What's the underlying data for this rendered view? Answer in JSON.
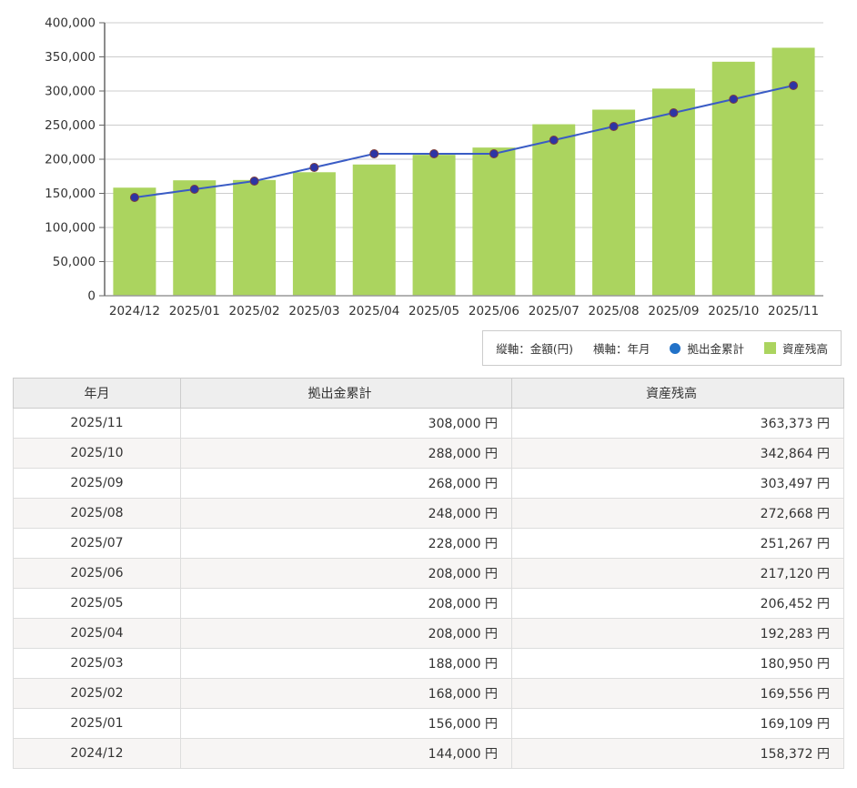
{
  "chart": {
    "legend": {
      "y_axis_label": "縦軸：金額(円)",
      "x_axis_label": "横軸：年月",
      "line_series_label": "拠出金累計",
      "bar_series_label": "資産残高"
    },
    "colors": {
      "bar": "#abd45f",
      "line": "#3a5cc5",
      "marker_fill": "#2d35a5",
      "marker_stroke": "#7c3f3f",
      "legend_dot": "#2272c8",
      "grid": "#cccccc",
      "axis": "#666666",
      "baseline": "#999999",
      "tick_text": "#333333"
    }
  },
  "chart_data": {
    "type": "bar",
    "categories": [
      "2024/12",
      "2025/01",
      "2025/02",
      "2025/03",
      "2025/04",
      "2025/05",
      "2025/06",
      "2025/07",
      "2025/08",
      "2025/09",
      "2025/10",
      "2025/11"
    ],
    "series": [
      {
        "name": "拠出金累計",
        "type": "line",
        "values": [
          144000,
          156000,
          168000,
          188000,
          208000,
          208000,
          208000,
          228000,
          248000,
          268000,
          288000,
          308000
        ]
      },
      {
        "name": "資産残高",
        "type": "bar",
        "values": [
          158372,
          169109,
          169556,
          180950,
          192283,
          206452,
          217120,
          251267,
          272668,
          303497,
          342864,
          363373
        ]
      }
    ],
    "title": "",
    "xlabel": "年月",
    "ylabel": "金額(円)",
    "ylim": [
      0,
      400000
    ],
    "ytick_step": 50000,
    "grid": true,
    "legend_position": "bottom-right"
  },
  "table": {
    "headers": [
      "年月",
      "拠出金累計",
      "資産残高"
    ],
    "rows": [
      [
        "2025/11",
        "308,000 円",
        "363,373 円"
      ],
      [
        "2025/10",
        "288,000 円",
        "342,864 円"
      ],
      [
        "2025/09",
        "268,000 円",
        "303,497 円"
      ],
      [
        "2025/08",
        "248,000 円",
        "272,668 円"
      ],
      [
        "2025/07",
        "228,000 円",
        "251,267 円"
      ],
      [
        "2025/06",
        "208,000 円",
        "217,120 円"
      ],
      [
        "2025/05",
        "208,000 円",
        "206,452 円"
      ],
      [
        "2025/04",
        "208,000 円",
        "192,283 円"
      ],
      [
        "2025/03",
        "188,000 円",
        "180,950 円"
      ],
      [
        "2025/02",
        "168,000 円",
        "169,556 円"
      ],
      [
        "2025/01",
        "156,000 円",
        "169,109 円"
      ],
      [
        "2024/12",
        "144,000 円",
        "158,372 円"
      ]
    ]
  }
}
